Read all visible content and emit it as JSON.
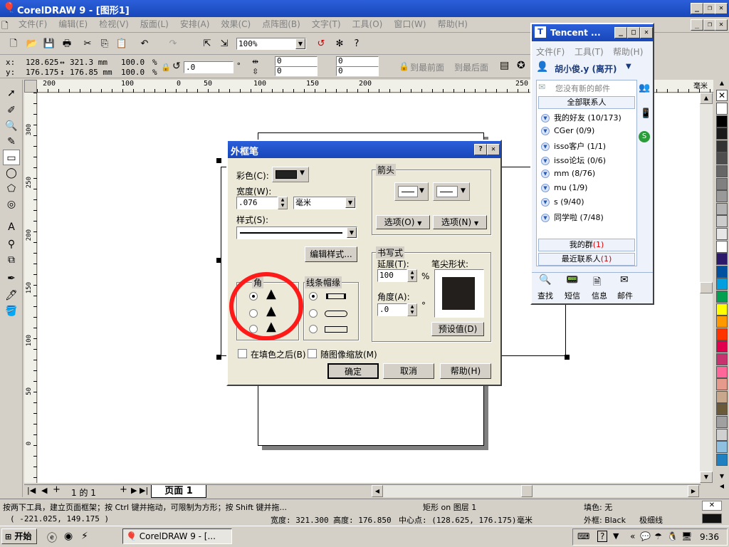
{
  "app": {
    "title": "CorelDRAW 9 - [图形1]",
    "menu": [
      "文件(F)",
      "编辑(E)",
      "检视(V)",
      "版面(L)",
      "安排(A)",
      "效果(C)",
      "点阵图(B)",
      "文字(T)",
      "工具(O)",
      "窗口(W)",
      "帮助(H)"
    ],
    "zoom": "100%"
  },
  "propbar": {
    "x_label": "x:",
    "x_value": "128.625",
    "y_label": "y:",
    "y_value": "176.175",
    "w_value": "321.3 mm",
    "h_value": "176.85 mm",
    "scale_x": "100.0",
    "scale_y": "100.0",
    "pct": "%",
    "angle": ".0",
    "corner1": "0",
    "corner2": "0",
    "corner3": "0",
    "corner4": "0",
    "to_front": "到最前面",
    "to_back": "到最后面"
  },
  "ruler": {
    "h_ticks": [
      "200",
      "100",
      "0",
      "50",
      "100",
      "150",
      "200",
      "250"
    ],
    "v_ticks": [
      "300",
      "250",
      "200",
      "150",
      "100",
      "50",
      "0"
    ],
    "unit": "毫米"
  },
  "dialog": {
    "title": "外框笔",
    "color_label": "彩色(C):",
    "width_label": "宽度(W):",
    "width_value": ".076",
    "unit_value": "毫米",
    "style_label": "样式(S):",
    "edit_style_button": "编辑样式...",
    "arrows_group": "箭头",
    "option_left": "选项(O)",
    "option_right": "选项(N)",
    "calligraphy_group": "书写式",
    "stretch_label": "延展(T):",
    "stretch_value": "100",
    "stretch_unit": "%",
    "angle_label": "角度(A):",
    "angle_value": ".0",
    "angle_unit": "°",
    "nib_shape_label": "笔尖形状:",
    "default_button": "预设值(D)",
    "corners_group": "角",
    "line_caps_group": "线条帽缘",
    "behind_fill_label": "在填色之后(B)",
    "scale_with_image_label": "随图像缩放(M)",
    "ok_button": "确定",
    "cancel_button": "取消",
    "help_button": "帮助(H)"
  },
  "qq": {
    "title": "Tencent ...",
    "menu": [
      "文件(F)",
      "工具(T)",
      "帮助(H)"
    ],
    "user": "胡小俊.y (离开)",
    "mail_notice": "您没有新的邮件",
    "all_contacts": "全部联系人",
    "groups": [
      "我的好友 (10/173)",
      "CGer (0/9)",
      "isso客户 (1/1)",
      "isso论坛 (0/6)",
      "mm (8/76)",
      "mu (1/9)",
      "s (9/40)",
      "同学啦 (7/48)"
    ],
    "my_groups": "我的群",
    "my_groups_count": "(1)",
    "recent": "最近联系人",
    "recent_count": "(1)",
    "bottom": [
      "查找",
      "短信",
      "信息",
      "邮件"
    ]
  },
  "pages": {
    "page_count": "1 的 1",
    "page_tab": "页面 1"
  },
  "status": {
    "hint": "按两下工具，建立页面框架；按 Ctrl 键并拖动，可限制为方形；按 Shift 键并拖...",
    "object": "矩形 on 图层 1",
    "fill": "填色: 无",
    "coords": "( -221.025, 149.175 )",
    "width": "宽度: 321.300",
    "height": "高度: 176.850",
    "center": "中心点: (128.625, 176.175)",
    "unit": "毫米",
    "outline": "外框: Black",
    "outline_width": "极细线"
  },
  "taskbar": {
    "start": "开始",
    "task": "CorelDRAW 9 - [...",
    "clock": "9:36"
  },
  "palette": [
    "#ffffff",
    "#000000",
    "#1a1a1a",
    "#333333",
    "#4d4d4d",
    "#666666",
    "#808080",
    "#999999",
    "#b3b3b3",
    "#cccccc",
    "#e6e6e6",
    "#ffffff",
    "#2e1a6b",
    "#0050a0",
    "#00a0e0",
    "#00a050",
    "#ffff00",
    "#ff9900",
    "#ff3300",
    "#e0004e",
    "#c8326e",
    "#ff6699",
    "#e59a8c",
    "#c8a88c",
    "#6b5a3a",
    "#a0a0a0",
    "#d0d0d0",
    "#90c0e0",
    "#2080c0"
  ]
}
